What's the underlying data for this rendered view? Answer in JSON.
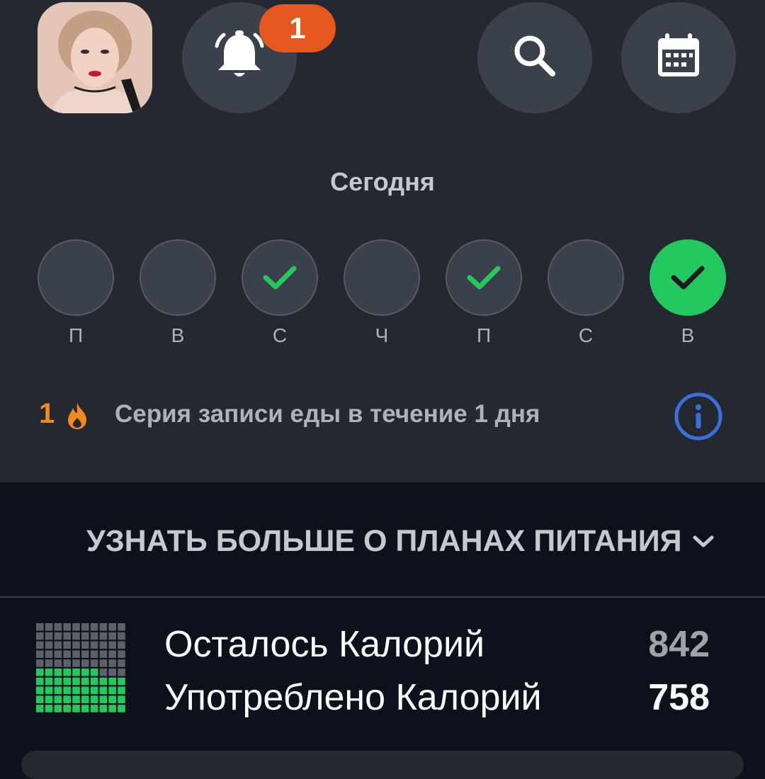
{
  "header": {
    "notification_count": "1",
    "icons": {
      "avatar": "user-avatar-photo",
      "notifications": "bell-icon",
      "search": "search-icon",
      "calendar": "calendar-icon"
    }
  },
  "today": {
    "title": "Сегодня",
    "days": [
      {
        "label": "П",
        "status": "empty"
      },
      {
        "label": "В",
        "status": "empty"
      },
      {
        "label": "С",
        "status": "checked"
      },
      {
        "label": "Ч",
        "status": "empty"
      },
      {
        "label": "П",
        "status": "checked"
      },
      {
        "label": "С",
        "status": "empty"
      },
      {
        "label": "В",
        "status": "today-checked"
      }
    ]
  },
  "streak": {
    "count": "1",
    "text": "Серия записи еды в течение 1 дня",
    "icons": {
      "flame": "flame-icon",
      "info": "info-icon"
    }
  },
  "plans_link": {
    "label": "УЗНАТЬ БОЛЬШЕ О ПЛАНАХ ПИТАНИЯ",
    "icon": "chevron-down-icon"
  },
  "calories": {
    "remaining_label": "Осталось Калорий",
    "remaining_value": "842",
    "consumed_label": "Употреблено Калорий",
    "consumed_value": "758",
    "consumed_fraction": 0.47
  },
  "colors": {
    "panel": "#232831",
    "background": "#0d111b",
    "accent_green": "#23c85e",
    "badge_orange": "#e4571f",
    "streak_orange": "#f08a1e",
    "info_blue": "#3b6fd9"
  }
}
